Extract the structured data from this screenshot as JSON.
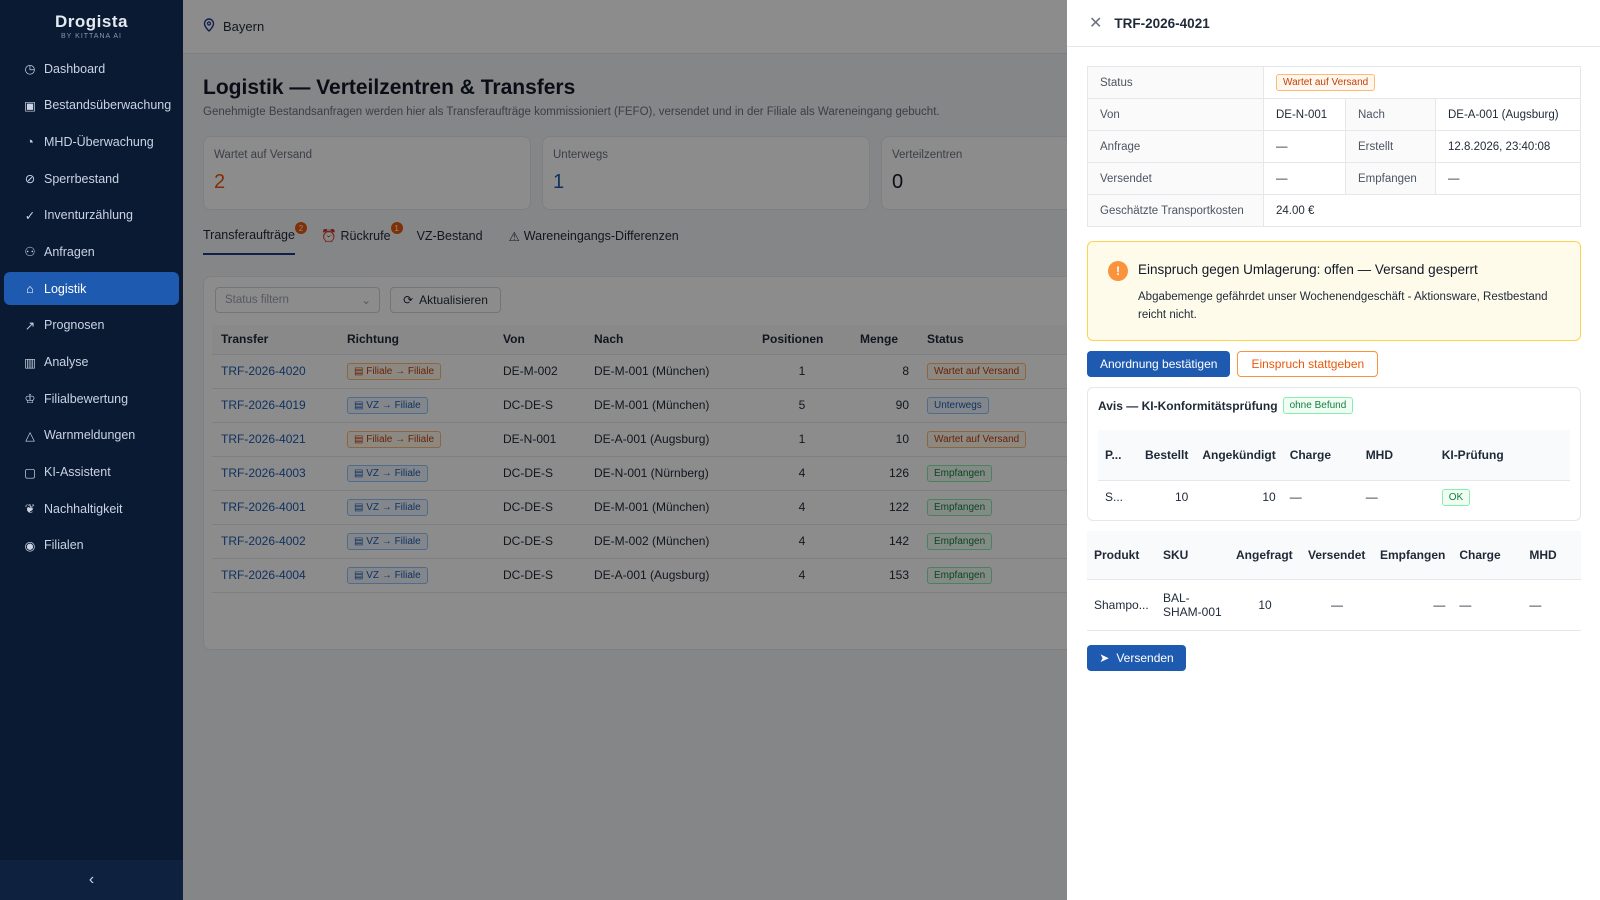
{
  "sidebar": {
    "brand": "Drogista",
    "brand_sub": "BY KITTANA AI",
    "items": [
      {
        "label": "Dashboard",
        "icon": "dashboard-icon"
      },
      {
        "label": "Bestandsüberwachung",
        "icon": "box-icon"
      },
      {
        "label": "MHD-Überwachung",
        "icon": "clock-icon"
      },
      {
        "label": "Sperrbestand",
        "icon": "block-icon"
      },
      {
        "label": "Inventurzählung",
        "icon": "check-circle-icon"
      },
      {
        "label": "Anfragen",
        "icon": "users-icon"
      },
      {
        "label": "Logistik",
        "icon": "warehouse-icon",
        "active": true
      },
      {
        "label": "Prognosen",
        "icon": "trend-icon"
      },
      {
        "label": "Analyse",
        "icon": "bar-chart-icon"
      },
      {
        "label": "Filialbewertung",
        "icon": "trophy-icon"
      },
      {
        "label": "Warnmeldungen",
        "icon": "bell-icon"
      },
      {
        "label": "KI-Assistent",
        "icon": "robot-icon"
      },
      {
        "label": "Nachhaltigkeit",
        "icon": "leaf-icon"
      },
      {
        "label": "Filialen",
        "icon": "map-pin-icon"
      }
    ]
  },
  "topbar": {
    "region": "Bayern"
  },
  "page": {
    "title": "Logistik — Verteilzentren & Transfers",
    "subtitle": "Genehmigte Bestandsanfragen werden hier als Transferaufträge kommissioniert (FEFO), versendet und in der Filiale als Wareneingang gebucht."
  },
  "stats": [
    {
      "label": "Wartet auf Versand",
      "value": "2",
      "color": "#ea580c"
    },
    {
      "label": "Unterwegs",
      "value": "1",
      "color": "#1e5bb0"
    },
    {
      "label": "Verteilzentren",
      "value": "0",
      "color": "#111827"
    }
  ],
  "tabs": [
    {
      "label": "Transferaufträge",
      "badge": "2"
    },
    {
      "label": "Rückrufe",
      "badge": "1"
    },
    {
      "label": "VZ-Bestand",
      "badge": ""
    },
    {
      "label": "Wareneingangs-Differenzen",
      "badge": ""
    }
  ],
  "toolbar": {
    "filter_placeholder": "Status filtern",
    "refresh_label": "Aktualisieren"
  },
  "table": {
    "headers": [
      "Transfer",
      "Richtung",
      "Von",
      "Nach",
      "Positionen",
      "Menge",
      "Status"
    ],
    "rows": [
      {
        "id": "TRF-2026-4020",
        "dir": "Filiale → Filiale",
        "dir_kind": "orange",
        "from": "DE-M-002",
        "to": "DE-M-001 (München)",
        "pos": "1",
        "qty": "8",
        "status": "Wartet auf Versand",
        "status_kind": "orange"
      },
      {
        "id": "TRF-2026-4019",
        "dir": "VZ → Filiale",
        "dir_kind": "blue",
        "from": "DC-DE-S",
        "to": "DE-M-001 (München)",
        "pos": "5",
        "qty": "90",
        "status": "Unterwegs",
        "status_kind": "blue"
      },
      {
        "id": "TRF-2026-4021",
        "dir": "Filiale → Filiale",
        "dir_kind": "orange",
        "from": "DE-N-001",
        "to": "DE-A-001 (Augsburg)",
        "pos": "1",
        "qty": "10",
        "status": "Wartet auf Versand",
        "status_kind": "orange"
      },
      {
        "id": "TRF-2026-4003",
        "dir": "VZ → Filiale",
        "dir_kind": "blue",
        "from": "DC-DE-S",
        "to": "DE-N-001 (Nürnberg)",
        "pos": "4",
        "qty": "126",
        "status": "Empfangen",
        "status_kind": "green"
      },
      {
        "id": "TRF-2026-4001",
        "dir": "VZ → Filiale",
        "dir_kind": "blue",
        "from": "DC-DE-S",
        "to": "DE-M-001 (München)",
        "pos": "4",
        "qty": "122",
        "status": "Empfangen",
        "status_kind": "green"
      },
      {
        "id": "TRF-2026-4002",
        "dir": "VZ → Filiale",
        "dir_kind": "blue",
        "from": "DC-DE-S",
        "to": "DE-M-002 (München)",
        "pos": "4",
        "qty": "142",
        "status": "Empfangen",
        "status_kind": "green"
      },
      {
        "id": "TRF-2026-4004",
        "dir": "VZ → Filiale",
        "dir_kind": "blue",
        "from": "DC-DE-S",
        "to": "DE-A-001 (Augsburg)",
        "pos": "4",
        "qty": "153",
        "status": "Empfangen",
        "status_kind": "green"
      }
    ]
  },
  "drawer": {
    "title": "TRF-2026-4021",
    "details": {
      "status_label": "Status",
      "status_value": "Wartet auf Versand",
      "von_label": "Von",
      "von_value": "DE-N-001",
      "nach_label": "Nach",
      "nach_value": "DE-A-001 (Augsburg)",
      "anfrage_label": "Anfrage",
      "anfrage_value": "—",
      "erstellt_label": "Erstellt",
      "erstellt_value": "12.8.2026, 23:40:08",
      "versendet_label": "Versendet",
      "versendet_value": "—",
      "empfangen_label": "Empfangen",
      "empfangen_value": "—",
      "kosten_label": "Geschätzte Transportkosten",
      "kosten_value": "24.00 €"
    },
    "alert": {
      "title": "Einspruch gegen Umlagerung: offen — Versand gesperrt",
      "text": "Abgabemenge gefährdet unser Wochenendgeschäft - Aktionsware, Restbestand reicht nicht."
    },
    "confirm_label": "Anordnung bestätigen",
    "grant_label": "Einspruch stattgeben",
    "avis": {
      "title": "Avis — KI-Konformitätsprüfung",
      "badge": "ohne Befund",
      "headers": [
        "P...",
        "Bestellt",
        "Angekündigt",
        "Charge",
        "MHD",
        "KI-Prüfung"
      ],
      "row": {
        "p": "S...",
        "bestellt": "10",
        "angekuendigt": "10",
        "charge": "—",
        "mhd": "—",
        "ki": "OK"
      }
    },
    "positions": {
      "headers": [
        "Produkt",
        "SKU",
        "Angefragt",
        "Versendet",
        "Empfangen",
        "Charge",
        "MHD"
      ],
      "row": {
        "produkt": "Shampo...",
        "sku": "BAL-SHAM-001",
        "angefragt": "10",
        "versendet": "—",
        "empfangen": "—",
        "charge": "—",
        "mhd": "—"
      }
    },
    "send_label": "Versenden"
  }
}
